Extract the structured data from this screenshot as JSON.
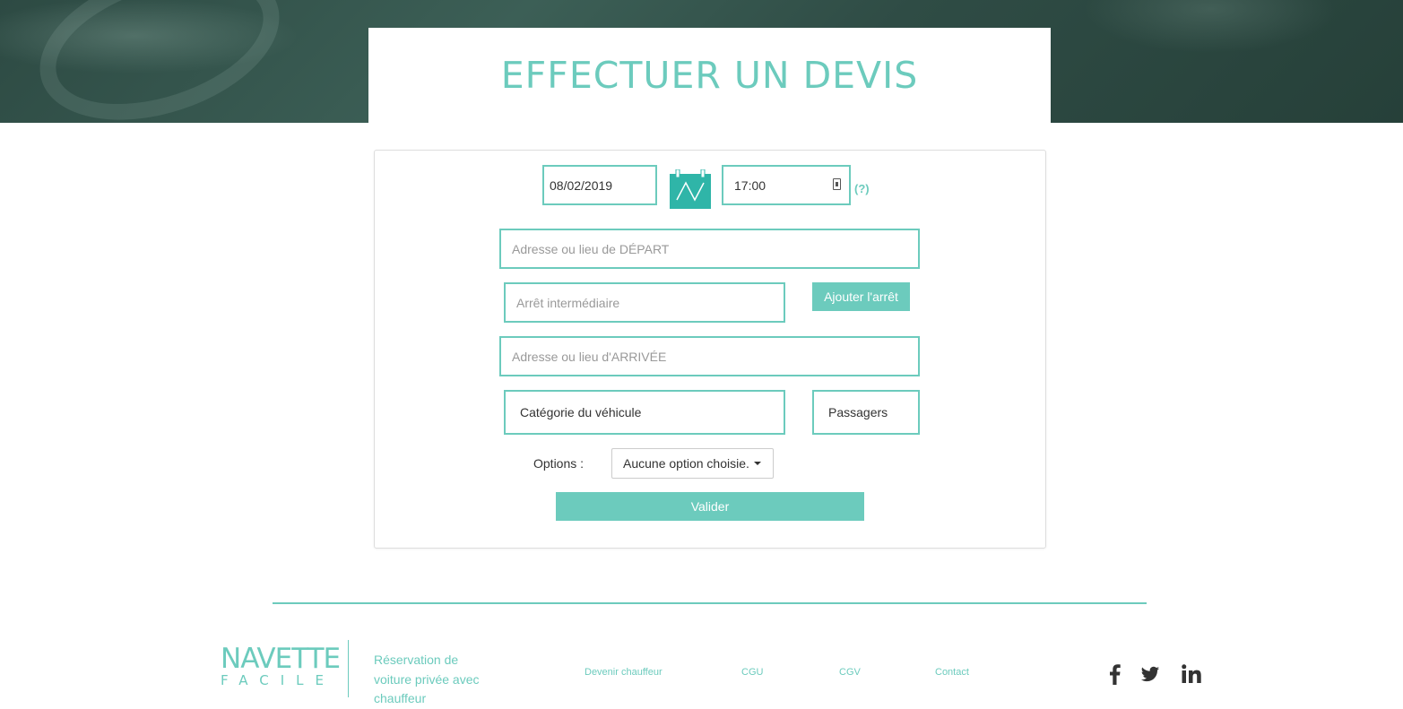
{
  "header": {
    "title": "EFFECTUER UN DEVIS"
  },
  "form": {
    "date_value": "08/02/2019",
    "time_value": "17:00",
    "help_label": "(?)",
    "depart_placeholder": "Adresse ou lieu de DÉPART",
    "stop_placeholder": "Arrêt intermédiaire",
    "add_stop_label": "Ajouter l'arrêt",
    "arrive_placeholder": "Adresse ou lieu d'ARRIVÉE",
    "category_label": "Catégorie du véhicule",
    "passengers_label": "Passagers",
    "options_label": "Options :",
    "options_value": "Aucune option choisie.",
    "submit_label": "Valider"
  },
  "footer": {
    "logo_line1": "NAVETTE",
    "logo_line2": "FACILE",
    "tagline": "Réservation de voiture privée avec chauffeur",
    "links": [
      "Devenir chauffeur",
      "CGU",
      "CGV",
      "Contact"
    ],
    "social_icons": [
      "facebook-icon",
      "twitter-icon",
      "linkedin-icon"
    ]
  },
  "colors": {
    "accent": "#6ccbbd",
    "hero_dark": "#2d4a43"
  }
}
